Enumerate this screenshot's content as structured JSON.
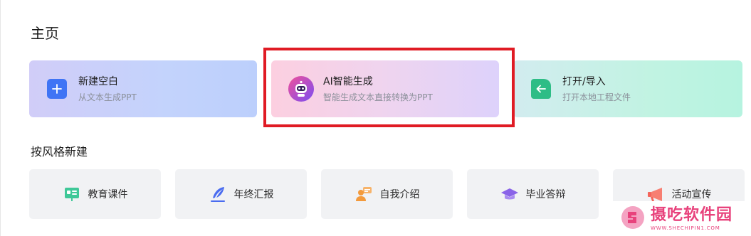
{
  "page": {
    "title": "主页"
  },
  "cards": {
    "new_blank": {
      "title": "新建空白",
      "subtitle": "从文本生成PPT",
      "icon": "plus-icon"
    },
    "ai_generate": {
      "title": "AI智能生成",
      "subtitle": "智能生成文本直接转换为PPT",
      "icon": "robot-icon"
    },
    "open_import": {
      "title": "打开/导入",
      "subtitle": "打开本地工程文件",
      "icon": "file-import-icon"
    }
  },
  "styles_section": {
    "title": "按风格新建",
    "items": [
      {
        "label": "教育课件",
        "icon": "presentation-board-icon"
      },
      {
        "label": "年终汇报",
        "icon": "feather-pen-icon"
      },
      {
        "label": "自我介绍",
        "icon": "person-card-icon"
      },
      {
        "label": "毕业答辩",
        "icon": "graduation-cap-icon"
      },
      {
        "label": "活动宣传",
        "icon": "megaphone-icon"
      }
    ]
  },
  "watermark": {
    "title": "摄吃软件园",
    "url": "WWW.SHECHIPIN1.COM"
  },
  "colors": {
    "highlight": "#e01b24",
    "accent_blue": "#3f74f5",
    "accent_green": "#2ebd86",
    "watermark": "#e8427c"
  }
}
